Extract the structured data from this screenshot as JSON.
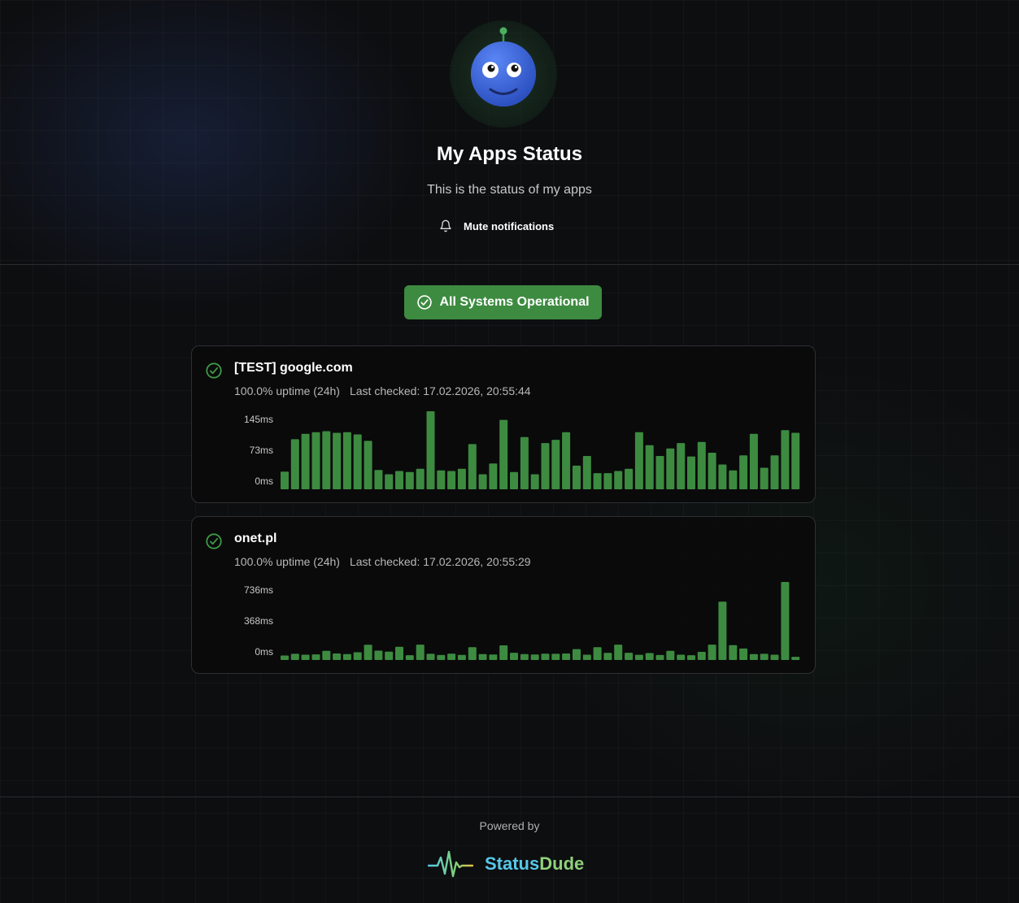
{
  "header": {
    "title": "My Apps Status",
    "subtitle": "This is the status of my apps",
    "mute_label": "Mute notifications"
  },
  "overall_status": {
    "label": "All Systems Operational",
    "color": "#3d8b40"
  },
  "monitors": [
    {
      "name": "[TEST] google.com",
      "uptime": "100.0% uptime (24h)",
      "last_checked": "Last checked: 17.02.2026, 20:55:44",
      "chart_data": {
        "type": "bar",
        "unit": "ms",
        "y_ticks": [
          "145ms",
          "73ms",
          "0ms"
        ],
        "ylim": [
          0,
          145
        ],
        "bar_color": "#3d8b40",
        "values": [
          33,
          93,
          103,
          106,
          108,
          105,
          106,
          102,
          90,
          36,
          28,
          34,
          32,
          38,
          145,
          35,
          34,
          38,
          84,
          28,
          48,
          129,
          32,
          97,
          28,
          86,
          92,
          106,
          44,
          62,
          30,
          30,
          34,
          38,
          106,
          82,
          62,
          76,
          86,
          61,
          88,
          68,
          46,
          35,
          63,
          103,
          40,
          63,
          110,
          105
        ]
      }
    },
    {
      "name": "onet.pl",
      "uptime": "100.0% uptime (24h)",
      "last_checked": "Last checked: 17.02.2026, 20:55:29",
      "chart_data": {
        "type": "bar",
        "unit": "ms",
        "y_ticks": [
          "736ms",
          "368ms",
          "0ms"
        ],
        "ylim": [
          0,
          736
        ],
        "bar_color": "#3d8b40",
        "values": [
          42,
          58,
          50,
          53,
          87,
          61,
          56,
          73,
          144,
          88,
          79,
          125,
          45,
          145,
          58,
          47,
          59,
          48,
          120,
          56,
          51,
          138,
          68,
          56,
          52,
          60,
          58,
          61,
          103,
          50,
          121,
          67,
          145,
          68,
          49,
          65,
          47,
          87,
          50,
          45,
          77,
          145,
          550,
          140,
          108,
          56,
          58,
          50,
          736,
          30
        ]
      }
    }
  ],
  "footer": {
    "powered_by": "Powered by",
    "brand_part1": "Status",
    "brand_part2": "Dude",
    "brand_color1": "#56c8e8",
    "brand_color2": "#8fd07a"
  }
}
